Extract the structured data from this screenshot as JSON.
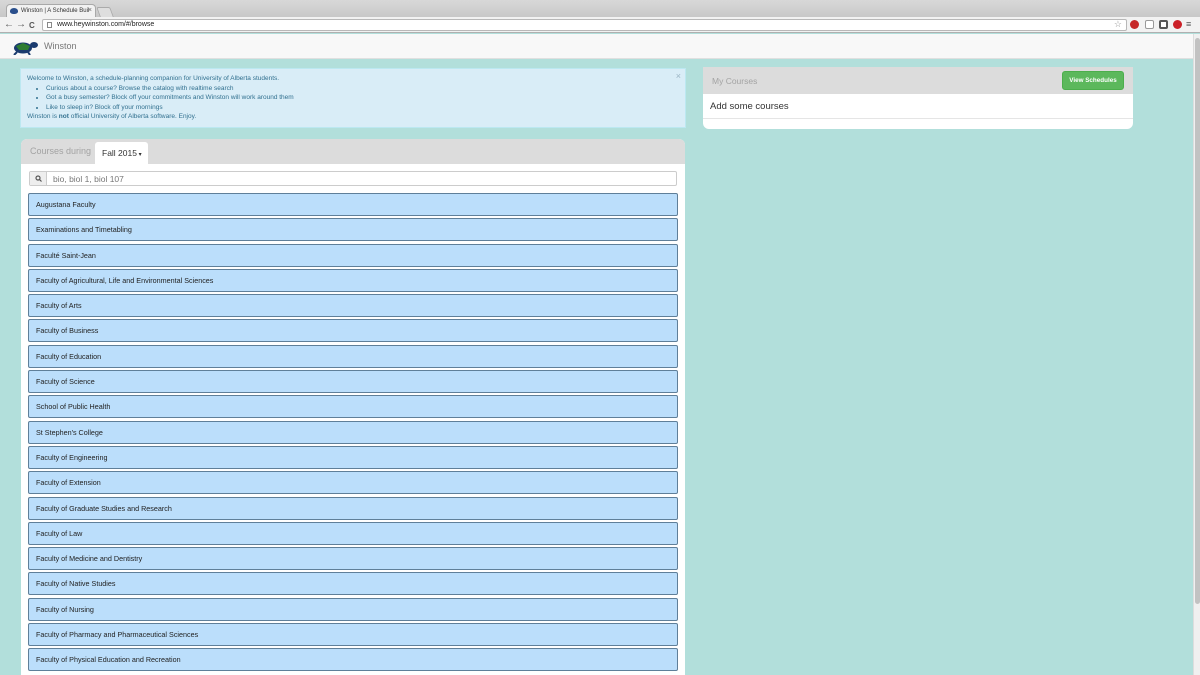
{
  "browser": {
    "tab_title": "Winston | A Schedule Buil",
    "tab_close": "×",
    "url": "www.heywinston.com/#/browse",
    "back": "←",
    "forward": "→",
    "reload": "C",
    "star": "☆",
    "menu": "≡"
  },
  "app": {
    "brand": "Winston"
  },
  "alert": {
    "intro": "Welcome to Winston, a schedule-planning companion for University of Alberta students.",
    "bullets": [
      "Curious about a course? Browse the catalog with realtime search",
      "Got a busy semester? Block off your commitments and Winston will work around them",
      "Like to sleep in? Block off your mornings"
    ],
    "footer_pre": "Winston is ",
    "footer_bold": "not",
    "footer_post": " official University of Alberta software. Enjoy.",
    "close": "×"
  },
  "courses_panel": {
    "heading": "Courses during",
    "term": "Fall 2015",
    "search_placeholder": "bio, biol 1, biol 107",
    "faculties": [
      "Augustana Faculty",
      "Examinations and Timetabling",
      "Faculté Saint-Jean",
      "Faculty of Agricultural, Life and Environmental Sciences",
      "Faculty of Arts",
      "Faculty of Business",
      "Faculty of Education",
      "Faculty of Science",
      "School of Public Health",
      "St Stephen's College",
      "Faculty of Engineering",
      "Faculty of Extension",
      "Faculty of Graduate Studies and Research",
      "Faculty of Law",
      "Faculty of Medicine and Dentistry",
      "Faculty of Native Studies",
      "Faculty of Nursing",
      "Faculty of Pharmacy and Pharmaceutical Sciences",
      "Faculty of Physical Education and Recreation"
    ]
  },
  "my_courses": {
    "title": "My Courses",
    "view_button": "View Schedules",
    "empty_text": "Add some courses"
  },
  "colors": {
    "page_bg": "#b2dfdb",
    "list_item_bg": "#bbdefb",
    "alert_bg": "#d9edf7",
    "button_green": "#5cb85c"
  }
}
